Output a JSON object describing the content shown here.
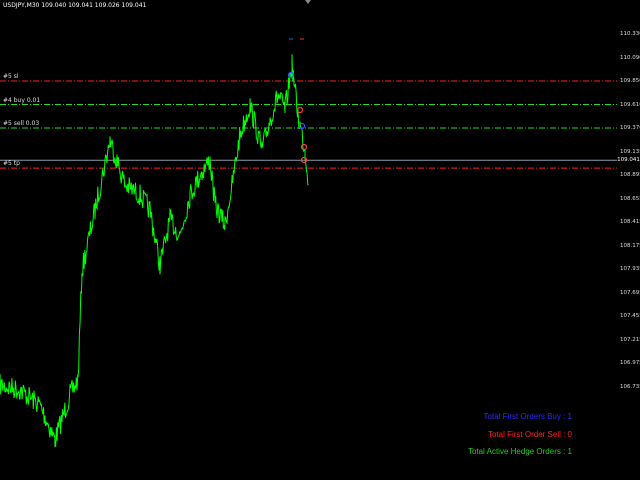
{
  "window": {
    "symbol_info": "USDJPY,M30  109.040 109.041 109.026 109.041"
  },
  "levels": [
    {
      "label": "#5 sl",
      "price": 109.85,
      "color": "#ff2020",
      "style": "dash-dot"
    },
    {
      "label": "#4 buy 0.01",
      "price": 109.61,
      "color": "#22dd22",
      "style": "dash-dot"
    },
    {
      "label": "#5 sell 0.03",
      "price": 109.37,
      "color": "#22dd22",
      "style": "dash-dot"
    },
    {
      "label": "#5 tp",
      "price": 108.96,
      "color": "#ff2020",
      "style": "dash-dot"
    }
  ],
  "current_price": {
    "value": 109.041,
    "label": "109.041",
    "line_color": "#8a9aa8"
  },
  "price_axis": {
    "range": [
      106.65,
      110.37
    ],
    "ticks": [
      "110.330",
      "110.090",
      "109.850",
      "109.610",
      "109.370",
      "109.135",
      "108.895",
      "108.655",
      "108.415",
      "108.175",
      "107.935",
      "107.695",
      "107.455",
      "107.215",
      "106.975",
      "106.735"
    ]
  },
  "colors": {
    "background": "#000000",
    "price_line": "#00ff00"
  },
  "stats": {
    "first_buy": {
      "text": "Total First Orders Buy : 1",
      "color": "#2a2aff"
    },
    "first_sell": {
      "text": "Total First Order Sell : 0",
      "color": "#ff2020"
    },
    "hedge": {
      "text": "Total Active Hedge Orders : 1",
      "color": "#22cc22"
    }
  }
}
